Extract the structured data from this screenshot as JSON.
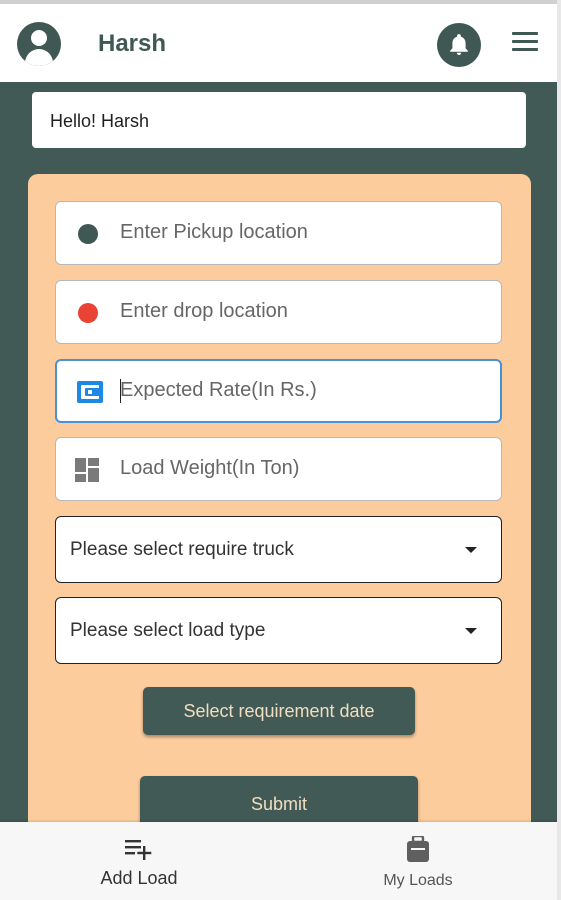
{
  "header": {
    "username": "Harsh",
    "avatar_icon": "account-circle-icon",
    "bell_icon": "notification-bell-icon",
    "menu_icon": "hamburger-menu-icon"
  },
  "greeting": "Hello! Harsh",
  "form": {
    "pickup_placeholder": "Enter Pickup location",
    "drop_placeholder": "Enter drop location",
    "rate_placeholder": "Expected Rate(In Rs.)",
    "weight_placeholder": "Load Weight(In Ton)",
    "truck_select": "Please select require truck",
    "load_type_select": "Please select load type",
    "date_button": "Select requirement date",
    "submit_button": "Submit"
  },
  "nav": {
    "add_load": "Add Load",
    "my_loads": "My Loads"
  },
  "colors": {
    "primary": "#415a55",
    "card": "#fdcc9c",
    "pickup_dot": "#3f5853",
    "drop_dot": "#ea4335",
    "rate_icon": "#1e88e5",
    "weight_icon": "#7a7a7a",
    "active_border": "#4a90d9",
    "button_text": "#f1ddc0"
  }
}
